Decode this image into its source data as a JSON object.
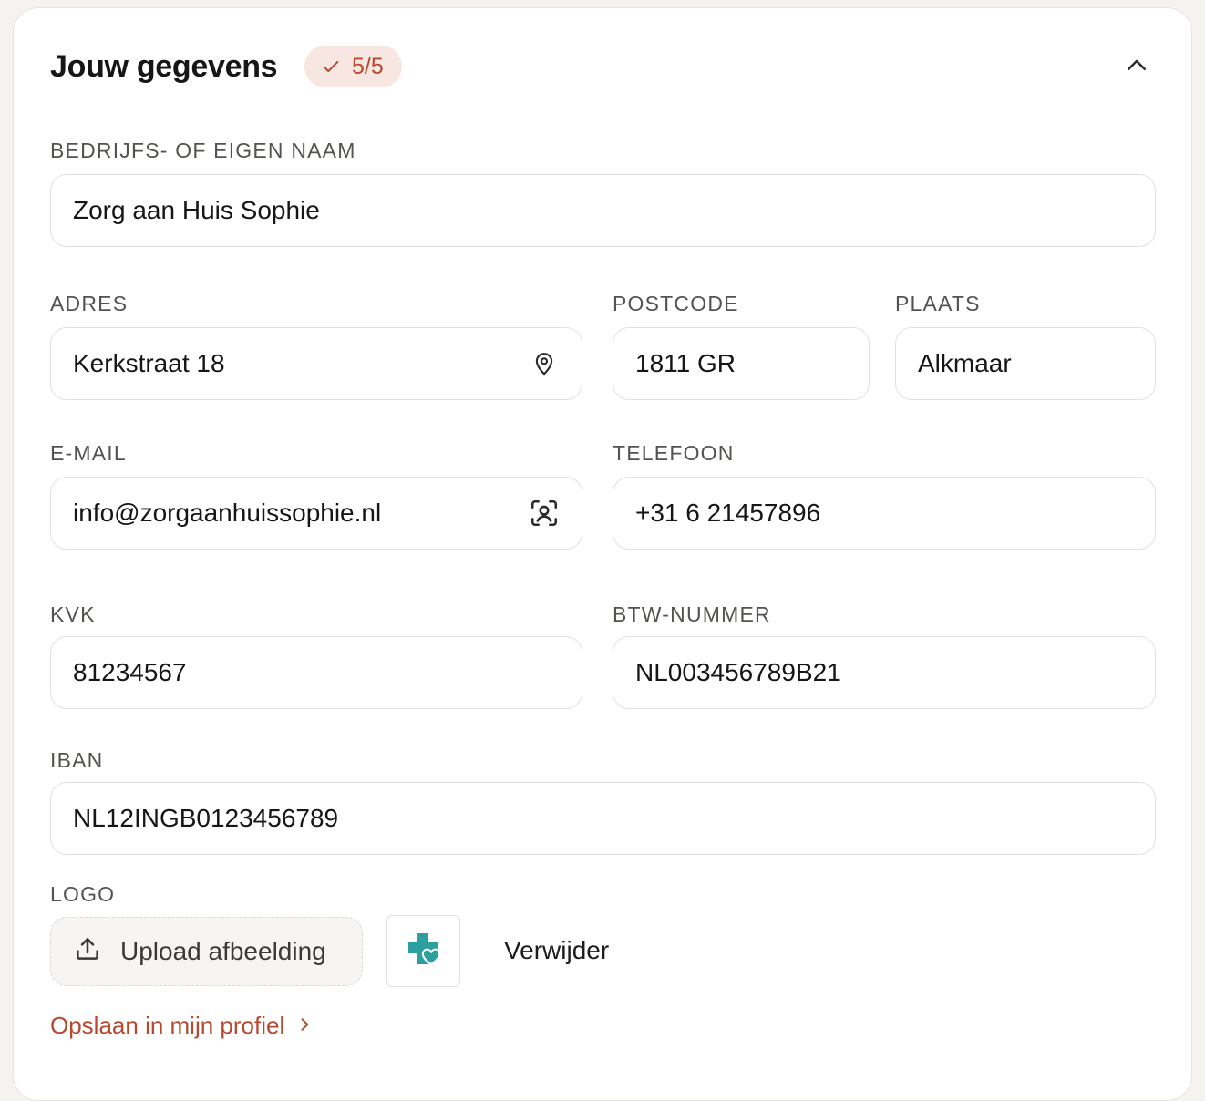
{
  "header": {
    "title": "Jouw gegevens",
    "badge_text": "5/5"
  },
  "fields": {
    "company_name": {
      "label": "BEDRIJFS- OF EIGEN NAAM",
      "value": "Zorg aan Huis Sophie"
    },
    "address": {
      "label": "ADRES",
      "value": "Kerkstraat 18"
    },
    "postcode": {
      "label": "POSTCODE",
      "value": "1811 GR"
    },
    "city": {
      "label": "PLAATS",
      "value": "Alkmaar"
    },
    "email": {
      "label": "E-MAIL",
      "value": "info@zorgaanhuissophie.nl"
    },
    "phone": {
      "label": "TELEFOON",
      "value": "+31 6 21457896"
    },
    "kvk": {
      "label": "KVK",
      "value": "81234567"
    },
    "vat": {
      "label": "BTW-NUMMER",
      "value": "NL003456789B21"
    },
    "iban": {
      "label": "IBAN",
      "value": "NL12INGB0123456789"
    }
  },
  "logo": {
    "label": "LOGO",
    "upload_label": "Upload afbeelding",
    "remove_label": "Verwijder"
  },
  "footer": {
    "save_label": "Opslaan in mijn profiel"
  },
  "icons": {
    "badge": "check-icon",
    "collapse": "chevron-up-icon",
    "address": "map-pin-icon",
    "email": "contact-scan-icon",
    "upload": "upload-icon",
    "logo": "medical-cross-heart-icon",
    "save": "chevron-right-icon"
  },
  "colors": {
    "accent": "#b8482e",
    "badge_bg": "#f7e6e1",
    "logo_teal": "#2e9fa0"
  }
}
